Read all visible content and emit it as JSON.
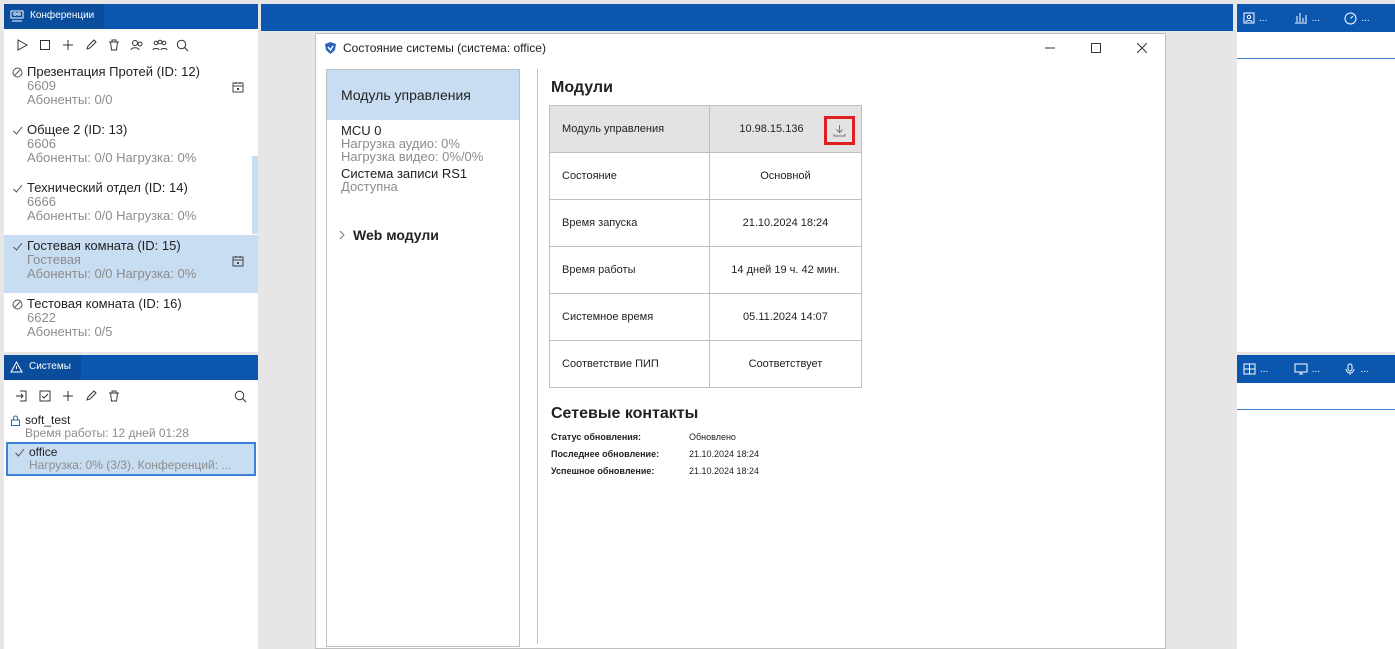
{
  "conferences": {
    "tab": "Конференции",
    "items": [
      {
        "status": "off",
        "title": "Презентация Протей (ID: 12)",
        "line1": "6609",
        "line2": "Абоненты: 0/0",
        "calendar": true,
        "selected": false
      },
      {
        "status": "on",
        "title": "Общее 2 (ID: 13)",
        "line1": "6606",
        "line2": "Абоненты: 0/0 Нагрузка: 0%",
        "calendar": false,
        "selected": false
      },
      {
        "status": "on",
        "title": "Технический отдел (ID: 14)",
        "line1": "6666",
        "line2": "Абоненты: 0/0 Нагрузка: 0%",
        "calendar": false,
        "selected": false
      },
      {
        "status": "on",
        "title": "Гостевая комната (ID: 15)",
        "line1": "Гостевая",
        "line2": "Абоненты: 0/0 Нагрузка: 0%",
        "calendar": true,
        "selected": true
      },
      {
        "status": "off",
        "title": "Тестовая комната (ID: 16)",
        "line1": "6622",
        "line2": "Абоненты: 0/5",
        "calendar": false,
        "selected": false
      }
    ]
  },
  "systems": {
    "tab": "Системы",
    "items": [
      {
        "title": "soft_test",
        "sub": "Время работы: 12 дней 01:28",
        "selected": false
      },
      {
        "title": "office",
        "sub": "Нагрузка: 0% (3/3). Конференций: ...",
        "selected": true
      }
    ]
  },
  "right_tabs_top": [
    "...",
    "...",
    "..."
  ],
  "right_tabs_bottom": [
    "...",
    "...",
    "..."
  ],
  "dialog": {
    "title": "Состояние системы (система: office)",
    "left": {
      "selected": "Модуль управления",
      "mcu_title": "MCU 0",
      "mcu_audio": "Нагрузка аудио: 0%",
      "mcu_video": "Нагрузка видео: 0%/0%",
      "rec_title": "Система записи RS1",
      "rec_status": "Доступна",
      "web": "Web модули"
    },
    "modules_title": "Модули",
    "modules": [
      {
        "key": "Модуль управления",
        "value": "10.98.15.136"
      },
      {
        "key": "Состояние",
        "value": "Основной"
      },
      {
        "key": "Время запуска",
        "value": "21.10.2024 18:24"
      },
      {
        "key": "Время работы",
        "value": "14 дней 19 ч. 42 мин."
      },
      {
        "key": "Системное время",
        "value": "05.11.2024 14:07"
      },
      {
        "key": "Соответствие ПИП",
        "value": "Соответствует"
      }
    ],
    "network_title": "Сетевые контакты",
    "network": [
      {
        "key": "Статус обновления:",
        "value": "Обновлено"
      },
      {
        "key": "Последнее обновление:",
        "value": "21.10.2024 18:24"
      },
      {
        "key": "Успешное обновление:",
        "value": "21.10.2024 18:24"
      }
    ]
  },
  "colors": {
    "accent": "#0b57b0",
    "selection": "#c8dcf2",
    "highlight": "#e02020"
  }
}
